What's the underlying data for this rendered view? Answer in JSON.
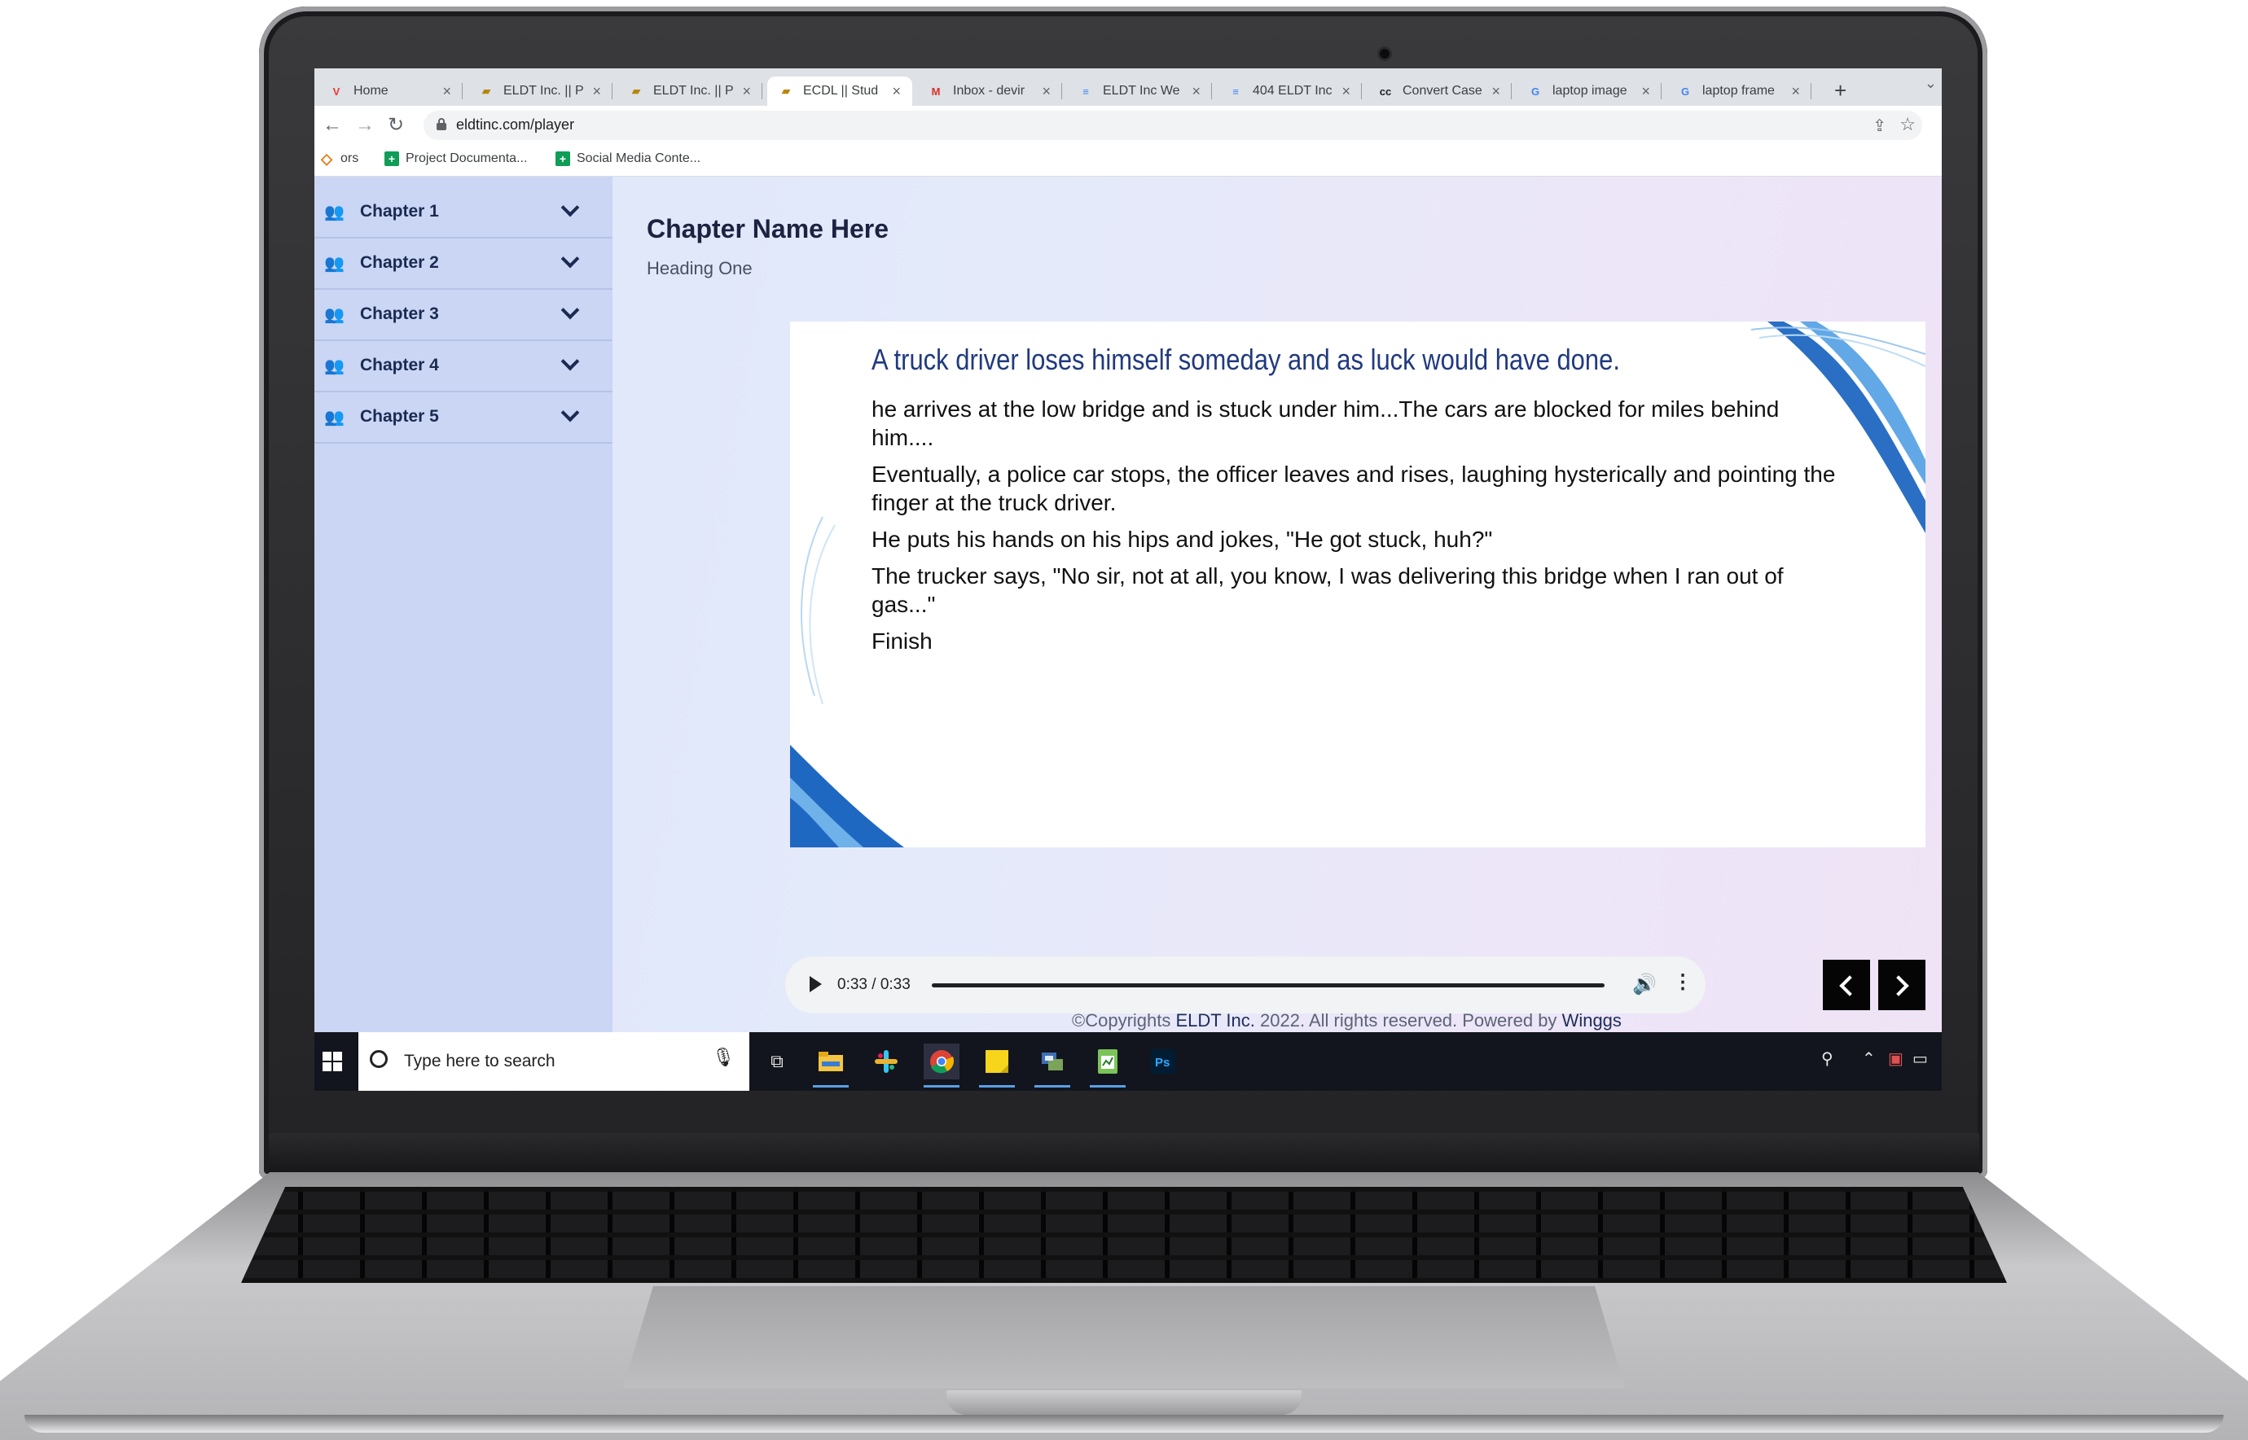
{
  "browser": {
    "tabs": [
      {
        "label": "Home",
        "icon": "vivaldi-icon",
        "active": false
      },
      {
        "label": "ELDT Inc. || P",
        "icon": "eldt-icon",
        "active": false
      },
      {
        "label": "ELDT Inc. || P",
        "icon": "eldt-icon",
        "active": false
      },
      {
        "label": "ECDL || Stud",
        "icon": "eldt-icon",
        "active": true
      },
      {
        "label": "Inbox - devir",
        "icon": "gmail-icon",
        "active": false
      },
      {
        "label": "ELDT Inc We",
        "icon": "docs-icon",
        "active": false
      },
      {
        "label": "404 ELDT Inc",
        "icon": "docs-icon",
        "active": false
      },
      {
        "label": "Convert Case",
        "icon": "cc-icon",
        "active": false
      },
      {
        "label": "laptop image",
        "icon": "google-icon",
        "active": false
      },
      {
        "label": "laptop frame",
        "icon": "google-icon",
        "active": false
      }
    ],
    "new_tab": "+",
    "url": "eldtinc.com/player",
    "bookmarks": [
      {
        "label": "ors",
        "icon": "ors-icon"
      },
      {
        "label": "Project Documenta...",
        "icon": "sheets-icon"
      },
      {
        "label": "Social Media Conte...",
        "icon": "sheets-icon"
      }
    ]
  },
  "sidebar": {
    "chapters": [
      {
        "label": "Chapter 1"
      },
      {
        "label": "Chapter 2"
      },
      {
        "label": "Chapter 3"
      },
      {
        "label": "Chapter 4"
      },
      {
        "label": "Chapter 5"
      }
    ]
  },
  "main": {
    "title": "Chapter Name Here",
    "subtitle": "Heading One",
    "card": {
      "heading": "A truck driver loses himself someday and as luck would have done.",
      "paragraphs": [
        "he arrives at the low bridge and is stuck under him...The cars are blocked for miles behind him....",
        "Eventually, a police car stops, the officer leaves and rises, laughing hysterically and pointing the finger at the truck driver.",
        "He puts his hands on his hips and jokes, \"He got stuck, huh?\"",
        "The trucker says, \"No sir, not at all, you know, I was delivering this bridge when I ran out of gas...\"",
        "Finish"
      ]
    },
    "audio": {
      "time": "0:33 / 0:33",
      "progress": 1.0
    }
  },
  "footer": {
    "prefix": "©Copyrights ",
    "company": "ELDT Inc.",
    "middle": " 2022. All rights reserved. Powered by ",
    "powered": "Winggs"
  },
  "taskbar": {
    "search_placeholder": "Type here to search",
    "apps": [
      "task-view-icon",
      "file-explorer-icon",
      "slack-icon",
      "chrome-icon",
      "sticky-notes-icon",
      "app-icon",
      "sheets-app-icon",
      "photoshop-icon"
    ],
    "photoshop_label": "Ps"
  },
  "colors": {
    "sidebar": "#cad6f4",
    "accent": "#213a7e",
    "taskbar": "#12151d"
  }
}
